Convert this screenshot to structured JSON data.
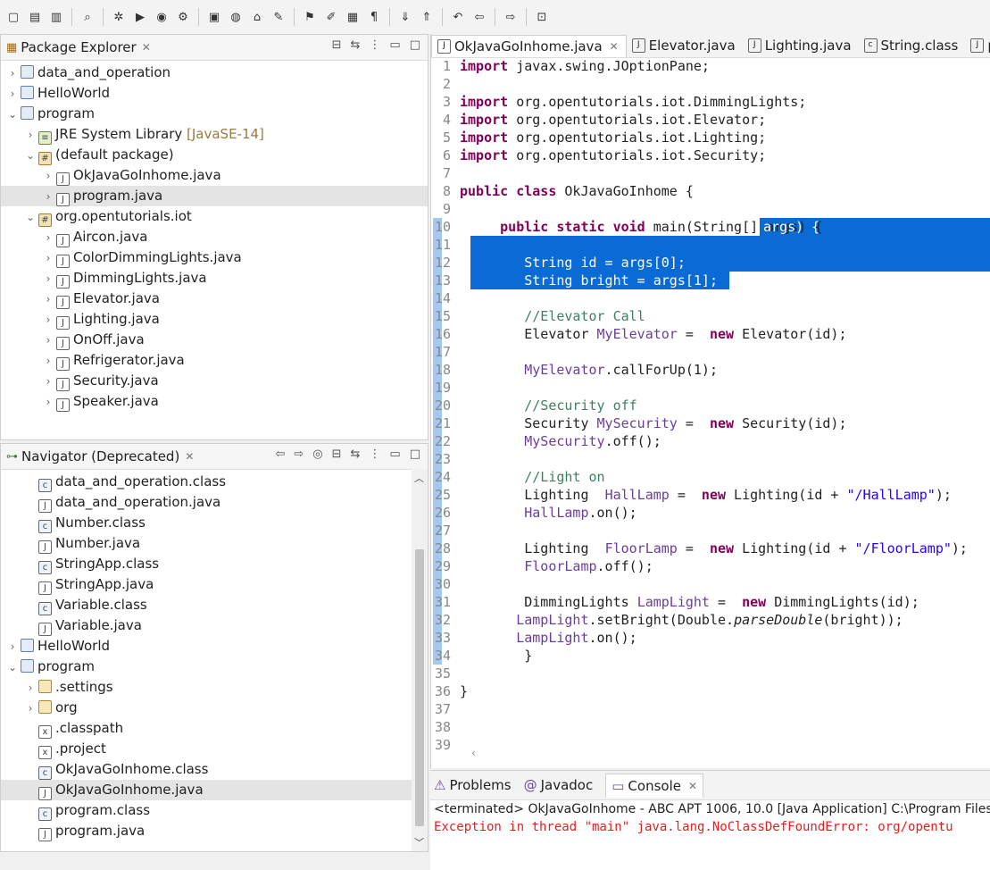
{
  "toolbar": {
    "buttons": [
      "new-icon",
      "save-icon",
      "save-all-icon",
      "search-icon",
      "debug-icon",
      "run-icon",
      "coverage-icon",
      "external-tools-icon",
      "new-java-package-icon",
      "new-class-icon",
      "open-type-icon",
      "open-task-icon",
      "toggle-breadcrumb-icon",
      "toggle-mark-occurrences-icon",
      "block-selection-icon",
      "show-whitespace-icon",
      "next-annotation-icon",
      "previous-annotation-icon",
      "last-edit-location-icon",
      "back-icon",
      "forward-icon",
      "pin-editor-icon"
    ]
  },
  "package_explorer": {
    "title": "Package Explorer",
    "items": [
      {
        "label": "data_and_operation",
        "indent": 0,
        "twisty": ">",
        "icon": "project",
        "sel": false
      },
      {
        "label": "HelloWorld",
        "indent": 0,
        "twisty": ">",
        "icon": "project",
        "sel": false
      },
      {
        "label": "program",
        "indent": 0,
        "twisty": "v",
        "icon": "project",
        "sel": false
      },
      {
        "label": "JRE System Library",
        "extra": "[JavaSE-14]",
        "indent": 1,
        "twisty": ">",
        "icon": "library",
        "sel": false
      },
      {
        "label": "(default package)",
        "indent": 1,
        "twisty": "v",
        "icon": "package",
        "sel": false
      },
      {
        "label": "OkJavaGoInhome.java",
        "indent": 2,
        "twisty": ">",
        "icon": "java-file",
        "sel": false
      },
      {
        "label": "program.java",
        "indent": 2,
        "twisty": ">",
        "icon": "java-file",
        "sel": true
      },
      {
        "label": "org.opentutorials.iot",
        "indent": 1,
        "twisty": "v",
        "icon": "package",
        "sel": false
      },
      {
        "label": "Aircon.java",
        "indent": 2,
        "twisty": ">",
        "icon": "java-file",
        "sel": false
      },
      {
        "label": "ColorDimmingLights.java",
        "indent": 2,
        "twisty": ">",
        "icon": "java-file",
        "sel": false
      },
      {
        "label": "DimmingLights.java",
        "indent": 2,
        "twisty": ">",
        "icon": "java-file",
        "sel": false
      },
      {
        "label": "Elevator.java",
        "indent": 2,
        "twisty": ">",
        "icon": "java-file",
        "sel": false
      },
      {
        "label": "Lighting.java",
        "indent": 2,
        "twisty": ">",
        "icon": "java-file",
        "sel": false
      },
      {
        "label": "OnOff.java",
        "indent": 2,
        "twisty": ">",
        "icon": "java-file",
        "sel": false
      },
      {
        "label": "Refrigerator.java",
        "indent": 2,
        "twisty": ">",
        "icon": "java-file",
        "sel": false
      },
      {
        "label": "Security.java",
        "indent": 2,
        "twisty": ">",
        "icon": "java-file",
        "sel": false
      },
      {
        "label": "Speaker.java",
        "indent": 2,
        "twisty": ">",
        "icon": "java-file",
        "sel": false
      }
    ]
  },
  "navigator": {
    "title": "Navigator (Deprecated)",
    "items": [
      {
        "label": "data_and_operation.class",
        "indent": 1,
        "twisty": "",
        "icon": "class-file",
        "sel": false
      },
      {
        "label": "data_and_operation.java",
        "indent": 1,
        "twisty": "",
        "icon": "java-file",
        "sel": false
      },
      {
        "label": "Number.class",
        "indent": 1,
        "twisty": "",
        "icon": "class-file",
        "sel": false
      },
      {
        "label": "Number.java",
        "indent": 1,
        "twisty": "",
        "icon": "java-file",
        "sel": false
      },
      {
        "label": "StringApp.class",
        "indent": 1,
        "twisty": "",
        "icon": "class-file",
        "sel": false
      },
      {
        "label": "StringApp.java",
        "indent": 1,
        "twisty": "",
        "icon": "java-file",
        "sel": false
      },
      {
        "label": "Variable.class",
        "indent": 1,
        "twisty": "",
        "icon": "class-file",
        "sel": false
      },
      {
        "label": "Variable.java",
        "indent": 1,
        "twisty": "",
        "icon": "java-file",
        "sel": false
      },
      {
        "label": "HelloWorld",
        "indent": 0,
        "twisty": ">",
        "icon": "project",
        "sel": false
      },
      {
        "label": "program",
        "indent": 0,
        "twisty": "v",
        "icon": "project",
        "sel": false
      },
      {
        "label": ".settings",
        "indent": 1,
        "twisty": ">",
        "icon": "folder",
        "sel": false
      },
      {
        "label": "org",
        "indent": 1,
        "twisty": ">",
        "icon": "folder",
        "sel": false
      },
      {
        "label": ".classpath",
        "indent": 1,
        "twisty": "",
        "icon": "xml-file",
        "sel": false
      },
      {
        "label": ".project",
        "indent": 1,
        "twisty": "",
        "icon": "xml-file",
        "sel": false
      },
      {
        "label": "OkJavaGoInhome.class",
        "indent": 1,
        "twisty": "",
        "icon": "class-file",
        "sel": false
      },
      {
        "label": "OkJavaGoInhome.java",
        "indent": 1,
        "twisty": "",
        "icon": "java-file",
        "sel": true
      },
      {
        "label": "program.class",
        "indent": 1,
        "twisty": "",
        "icon": "class-file",
        "sel": false
      },
      {
        "label": "program.java",
        "indent": 1,
        "twisty": "",
        "icon": "java-file",
        "sel": false
      }
    ]
  },
  "editor": {
    "tabs": [
      {
        "label": "OkJavaGoInhome.java",
        "active": true,
        "icon": "java-file"
      },
      {
        "label": "Elevator.java",
        "active": false,
        "icon": "java-file"
      },
      {
        "label": "Lighting.java",
        "active": false,
        "icon": "java-file"
      },
      {
        "label": "String.class",
        "active": false,
        "icon": "class-file"
      },
      {
        "label": "pr",
        "active": false,
        "icon": "java-file"
      }
    ],
    "lines": [
      [
        [
          "kw",
          "import"
        ],
        [
          "",
          "javax.swing.JOptionPane;"
        ]
      ],
      [],
      [
        [
          "kw",
          "import"
        ],
        [
          "",
          "org.opentutorials.iot.DimmingLights;"
        ]
      ],
      [
        [
          "kw",
          "import"
        ],
        [
          "",
          "org.opentutorials.iot.Elevator;"
        ]
      ],
      [
        [
          "kw",
          "import"
        ],
        [
          "",
          "org.opentutorials.iot.Lighting;"
        ]
      ],
      [
        [
          "kw",
          "import"
        ],
        [
          "",
          "org.opentutorials.iot.Security;"
        ]
      ],
      [],
      [
        [
          "kw",
          "public class"
        ],
        [
          "",
          " OkJavaGoInhome {"
        ]
      ],
      [],
      [
        [
          "",
          "    "
        ],
        [
          "kw",
          "public static void"
        ],
        [
          "",
          " main(String[] args) {"
        ]
      ],
      [],
      [
        [
          "",
          "        String id = args[0];"
        ]
      ],
      [
        [
          "",
          "        String bright = args[1];"
        ]
      ],
      [],
      [
        [
          "cm",
          "        //Elevator Call"
        ]
      ],
      [
        [
          "",
          "        Elevator "
        ],
        [
          "fld",
          "MyElevator"
        ],
        [
          "",
          " = "
        ],
        [
          "kw",
          "new"
        ],
        [
          "",
          " Elevator(id);"
        ]
      ],
      [],
      [
        [
          "fld",
          "        MyElevator"
        ],
        [
          "",
          ".callForUp(1);"
        ]
      ],
      [],
      [
        [
          "cm",
          "        //Security off"
        ]
      ],
      [
        [
          "",
          "        Security "
        ],
        [
          "fld",
          "MySecurity"
        ],
        [
          "",
          " = "
        ],
        [
          "kw",
          "new"
        ],
        [
          "",
          " Security(id);"
        ]
      ],
      [
        [
          "fld",
          "        MySecurity"
        ],
        [
          "",
          ".off();"
        ]
      ],
      [],
      [
        [
          "cm",
          "        //Light on"
        ]
      ],
      [
        [
          "",
          "        Lighting  "
        ],
        [
          "fld",
          "HallLamp"
        ],
        [
          "",
          " = "
        ],
        [
          "kw",
          "new"
        ],
        [
          "",
          " Lighting(id + "
        ],
        [
          "str",
          "\"/HallLamp\""
        ],
        [
          "",
          ");"
        ]
      ],
      [
        [
          "fld",
          "        HallLamp"
        ],
        [
          "",
          ".on();"
        ]
      ],
      [],
      [
        [
          "",
          "        Lighting  "
        ],
        [
          "fld",
          "FloorLamp"
        ],
        [
          "",
          " = "
        ],
        [
          "kw",
          "new"
        ],
        [
          "",
          " Lighting(id + "
        ],
        [
          "str",
          "\"/FloorLamp\""
        ],
        [
          "",
          ");"
        ]
      ],
      [
        [
          "fld",
          "        FloorLamp"
        ],
        [
          "",
          ".off();"
        ]
      ],
      [],
      [
        [
          "",
          "        DimmingLights "
        ],
        [
          "fld",
          "LampLight"
        ],
        [
          "",
          " = "
        ],
        [
          "kw",
          "new"
        ],
        [
          "",
          " DimmingLights(id);"
        ]
      ],
      [
        [
          "fld",
          "       LampLight"
        ],
        [
          "",
          ".setBright(Double."
        ],
        [
          "it",
          "parseDouble"
        ],
        [
          "",
          "(bright));"
        ]
      ],
      [
        [
          "fld",
          "       LampLight"
        ],
        [
          "",
          ".on();"
        ]
      ],
      [
        [
          "",
          "        }"
        ]
      ],
      [],
      [
        [
          "",
          "}"
        ]
      ],
      [],
      [],
      []
    ],
    "selection": {
      "from_line": 10,
      "from_col_text": "args) {",
      "to_line": 13
    }
  },
  "console": {
    "tabs": [
      {
        "label": "Problems",
        "icon": "problems-icon",
        "active": false
      },
      {
        "label": "Javadoc",
        "icon": "javadoc-icon",
        "active": false
      },
      {
        "label": "Console",
        "icon": "console-icon",
        "active": true
      }
    ],
    "terminated": "<terminated> OkJavaGoInhome - ABC APT 1006, 10.0 [Java Application] C:\\Program Files\\",
    "error": "Exception in thread \"main\" java.lang.NoClassDefFoundError: org/opentu"
  }
}
